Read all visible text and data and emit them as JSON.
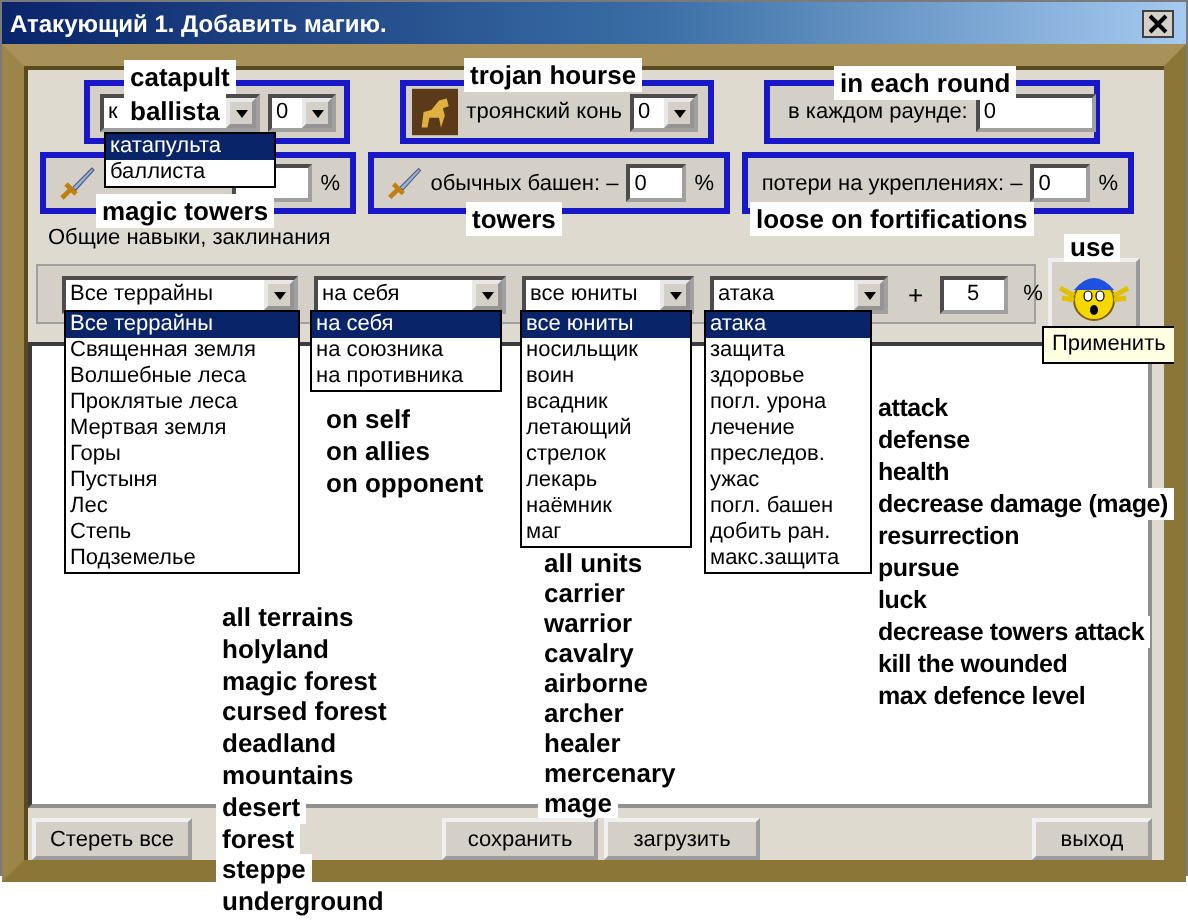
{
  "window": {
    "title": "Атакующий 1. Добавить магию."
  },
  "siege": {
    "weapon": {
      "value": "к",
      "options": [
        {
          "label": "катапульта",
          "selected": true
        },
        {
          "label": "баллиста",
          "selected": false
        }
      ]
    },
    "count": "0"
  },
  "trojan_horse": {
    "label": "троянский конь",
    "count": "0"
  },
  "each_round": {
    "label": "в каждом раунде:",
    "value": "0"
  },
  "magic_towers": {
    "unit": "%"
  },
  "towers": {
    "label": "обычных башен: –",
    "value": "0",
    "unit": "%"
  },
  "fortifications": {
    "label": "потери на укреплениях: –",
    "value": "0",
    "unit": "%"
  },
  "skills": {
    "title": "Общие навыки, заклинания",
    "terrain": {
      "value": "Все террайны",
      "options": [
        {
          "label": "Все террайны",
          "selected": true
        },
        {
          "label": "Священная земля",
          "selected": false
        },
        {
          "label": "Волшебные леса",
          "selected": false
        },
        {
          "label": "Проклятые леса",
          "selected": false
        },
        {
          "label": "Мертвая земля",
          "selected": false
        },
        {
          "label": "Горы",
          "selected": false
        },
        {
          "label": "Пустыня",
          "selected": false
        },
        {
          "label": "Лес",
          "selected": false
        },
        {
          "label": "Степь",
          "selected": false
        },
        {
          "label": "Подземелье",
          "selected": false
        }
      ]
    },
    "target": {
      "value": "на себя",
      "options": [
        {
          "label": "на себя",
          "selected": true
        },
        {
          "label": "на союзника",
          "selected": false
        },
        {
          "label": "на противника",
          "selected": false
        }
      ]
    },
    "units": {
      "value": "все юниты",
      "options": [
        {
          "label": "все юниты",
          "selected": true
        },
        {
          "label": "носильщик",
          "selected": false
        },
        {
          "label": "воин",
          "selected": false
        },
        {
          "label": "всадник",
          "selected": false
        },
        {
          "label": "летающий",
          "selected": false
        },
        {
          "label": "стрелок",
          "selected": false
        },
        {
          "label": "лекарь",
          "selected": false
        },
        {
          "label": "наёмник",
          "selected": false
        },
        {
          "label": "маг",
          "selected": false
        }
      ]
    },
    "effect": {
      "value": "атака",
      "options": [
        {
          "label": "атака",
          "selected": true
        },
        {
          "label": "защита",
          "selected": false
        },
        {
          "label": "здоровье",
          "selected": false
        },
        {
          "label": "погл. урона",
          "selected": false
        },
        {
          "label": "лечение",
          "selected": false
        },
        {
          "label": "преследов.",
          "selected": false
        },
        {
          "label": "ужас",
          "selected": false
        },
        {
          "label": "погл. башен",
          "selected": false
        },
        {
          "label": "добить ран.",
          "selected": false
        },
        {
          "label": "макс.защита",
          "selected": false
        }
      ]
    },
    "plus": "+",
    "amount": "5",
    "unit": "%"
  },
  "use_tooltip": "Применить",
  "buttons": [
    {
      "label": "Стереть все"
    },
    {
      "label": "сохранить"
    },
    {
      "label": "загрузить"
    },
    {
      "label": "выход"
    }
  ],
  "annotations": [
    {
      "lines": [
        "catapult",
        "ballista"
      ]
    },
    {
      "lines": [
        "trojan hourse"
      ]
    },
    {
      "lines": [
        "in each round"
      ]
    },
    {
      "lines": [
        "magic towers"
      ]
    },
    {
      "lines": [
        "towers"
      ]
    },
    {
      "lines": [
        "loose on fortifications"
      ]
    },
    {
      "lines": [
        "use"
      ]
    },
    {
      "lines": [
        "on self",
        "on allies",
        "on opponent"
      ]
    },
    {
      "lines": [
        "all units",
        "carrier",
        "warrior",
        "cavalry",
        "airborne",
        "archer",
        "healer",
        "mercenary",
        "mage"
      ]
    },
    {
      "lines": [
        "all terrains",
        "holyland",
        "magic forest",
        "cursed forest",
        "deadland",
        "mountains",
        "desert",
        "forest",
        "steppe",
        "underground"
      ]
    },
    {
      "lines": [
        "attack",
        "defense",
        "health",
        "decrease damage (mage)",
        "resurrection",
        "pursue",
        "luck",
        "decrease towers attack",
        "kill the wounded",
        "max defence level"
      ]
    }
  ]
}
